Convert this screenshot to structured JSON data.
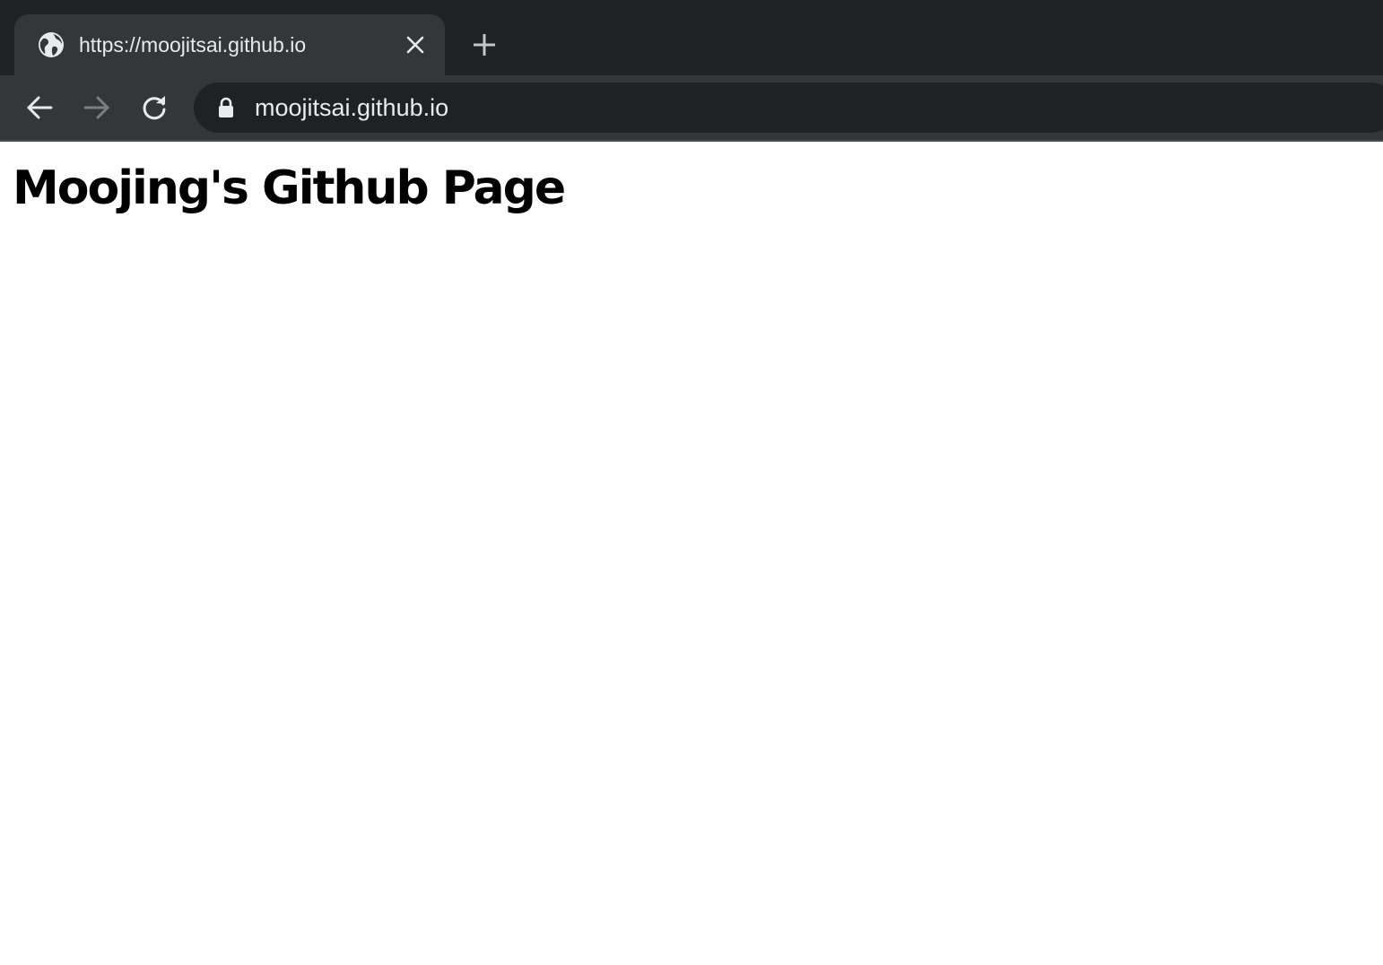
{
  "browser": {
    "tab": {
      "title": "https://moojitsai.github.io",
      "favicon_icon": "globe-icon",
      "close_icon": "close-icon"
    },
    "new_tab_icon": "plus-icon",
    "toolbar": {
      "back_icon": "arrow-left-icon",
      "forward_icon": "arrow-right-icon",
      "reload_icon": "reload-icon",
      "forward_enabled": false
    },
    "omnibox": {
      "secure_icon": "lock-icon",
      "url": "moojitsai.github.io"
    },
    "colors": {
      "tabstrip_bg": "#202124",
      "active_tab_bg": "#35363a",
      "omnibox_bg": "#202124",
      "text": "#e8eaed",
      "disabled_icon": "#7b7d80"
    }
  },
  "page": {
    "heading": "Moojing's Github Page",
    "background": "#ffffff"
  }
}
